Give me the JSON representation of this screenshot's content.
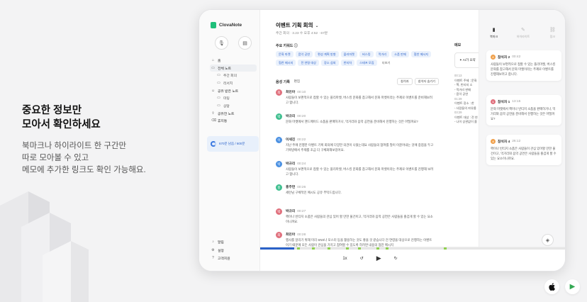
{
  "hero": {
    "headline_line1": "중요한 정보만",
    "headline_line2": "모아서 확인하세요",
    "body_line1": "북마크나 하이라이트 한 구간만",
    "body_line2": "따로 모아볼 수 있고",
    "body_line3": "메모에 추가한 링크도 확인 가능해요."
  },
  "app": {
    "logo_text": "ClovaNote",
    "sidebar": {
      "items": [
        {
          "label": "홈",
          "icon": "home-icon"
        },
        {
          "label": "전체 노트",
          "icon": "folder-icon"
        },
        {
          "label": "주간 회의",
          "icon": "folder-icon",
          "sub": true
        },
        {
          "label": "리서치",
          "icon": "folder-icon",
          "sub": true
        },
        {
          "label": "공유 받은 노트",
          "icon": "person-icon"
        },
        {
          "label": "미팅",
          "icon": "folder-icon",
          "sub": true
        },
        {
          "label": "상담",
          "icon": "folder-icon",
          "sub": true
        },
        {
          "label": "공유한 노트",
          "icon": "share-icon"
        },
        {
          "label": "휴지통",
          "icon": "trash-icon"
        }
      ],
      "storage": "670분 남음 / 600분",
      "bottom_items": [
        {
          "label": "알림",
          "icon": "bell-icon"
        },
        {
          "label": "설정",
          "icon": "gear-icon"
        },
        {
          "label": "고객지원",
          "icon": "help-icon"
        }
      ]
    },
    "note": {
      "title": "이벤트 기획 회의",
      "subtitle": "주간 회의 · 3.23 수 오후 4:52 · 67분",
      "keywords_label": "주요 키워드",
      "keywords": [
        "문화 마켓",
        "음악 공연",
        "편성 계획 방향",
        "플리마켓",
        "버스킹",
        "먹거리",
        "소품 판매",
        "협찬 메시지",
        "협찬 메시지",
        "전 연령 대상",
        "장소 섭외",
        "반지차",
        "스태프 모집"
      ],
      "keywords_more": "더보기",
      "record_label": "음성 기록",
      "record_edit": "편집",
      "btn_participants": "참석자",
      "btn_hide": "참석자 숨기기",
      "segments": [
        {
          "speaker": "최민아",
          "time": "00:10",
          "color": "#e0707d",
          "initial": "최",
          "text": "사람들이 보편적으로 접할 수 있는 플리마켓, 버스킹 문화를 참고해서 문화 마켓이라는 주제로 이벤트를 준비해보려고 합니다."
        },
        {
          "speaker": "박규리",
          "time": "00:20",
          "color": "#3fbf8f",
          "initial": "박",
          "text": "문화 마켓에서 핸드메이드 소품을 판매하거나, 먹거리와 음악 공연을 준비해서 진행하는 것은 어떨까요?"
        },
        {
          "speaker": "이세진",
          "time": "00:22",
          "color": "#4a90e2",
          "initial": "이",
          "text": "지난 주에 진행한 이벤트 기획 회의에 다양한 의견이 나왔는데요 사람들의 참여를 많이 이끌어내는 것에 중점을 두고 기획방에서 주제를 조금 더 구체화해보았어요."
        },
        {
          "speaker": "박규리",
          "time": "00:24",
          "color": "#4a90e2",
          "initial": "박",
          "text": "사람들이 보편적으로 접할 수 있는 플리마켓, 버스킹 문화를 참고해서 문화 마켓이라는 주제로 이벤트를 진행해 보려고 합니다."
        },
        {
          "speaker": "홍주연",
          "time": "00:26",
          "color": "#3fbf8f",
          "initial": "홍",
          "text": "세런님 구체적인 예시도 공유 부탁드립니다."
        },
        {
          "speaker": "박규리",
          "time": "00:27",
          "color": "#e0707d",
          "initial": "박",
          "text": "핵이나 빈티지 소품은 사람들의 관심 있어 할 만한 물건이고, 먹거리와 음악 공연은 사람들을 즐겁게 할 수 있는 요소이니까요."
        },
        {
          "speaker": "최민아",
          "time": "00:28",
          "color": "#e0707d",
          "initial": "최",
          "text": "행사를 알리기 위해 미리 SNS나 포스터 등을 활용하는 것도 좋을 것 같습니다 전 연령을 대상으로 진행하는 이벤트이기 때문에 모든 사람이 관심을 가지고 참여할 수 있도록 하려면 내용의 협찬 메시지"
        }
      ]
    },
    "player": {
      "speed": "1x",
      "progress": 0.11,
      "markers": [
        0.12,
        0.17,
        0.22,
        0.28,
        0.32,
        0.38,
        0.41,
        0.6
      ]
    },
    "memo": {
      "label": "메모",
      "ai_box": "AI가 요약",
      "lines": [
        {
          "ts": "00:13",
          "text": "이벤트 주제 : 문화"
        },
        {
          "ts": "",
          "text": "- 핵, 빈티지 소"
        },
        {
          "ts": "",
          "text": "- 먹거리 판매"
        },
        {
          "ts": "",
          "text": "- 음악 공연"
        },
        {
          "ts": "01:29",
          "text": "이벤트 장소 : 한"
        },
        {
          "ts": "",
          "text": "- 사람들의 자유롭"
        },
        {
          "ts": "03:29",
          "text": "이벤트 대상 : 전 연"
        },
        {
          "ts": "",
          "text": "- 나이 상관없이 즐"
        }
      ]
    },
    "panel": {
      "tabs": [
        {
          "label": "북마크",
          "icon": "bookmark-icon",
          "active": true
        },
        {
          "label": "하이라이트",
          "icon": "highlight-icon",
          "active": false
        },
        {
          "label": "링크",
          "icon": "link-icon",
          "active": false
        }
      ],
      "cards": [
        {
          "speaker": "참석자 2",
          "time": "00:42",
          "color": "#f0a04b",
          "initial": "2",
          "text": "사람들이 보편적으로 접할 수 있는 플리마켓, 버스킹 문화를 참고해서 문화 마켓이라는 주제로 이벤트를 진행해보려고 합니다."
        },
        {
          "speaker": "참석자 1",
          "time": "13:15",
          "color": "#e0707d",
          "initial": "1",
          "text": "문화 마켓에서 핵이나 빈티지 소품을 판매하거나, 먹거리와 음악 공연을 준비해서 진행하는 것은 어떨까요?"
        },
        {
          "speaker": "참석자 4",
          "time": "26:12",
          "color": "#f0a04b",
          "initial": "4",
          "text": "핵이나 빈티지 소품은 사람들이 관심 있어할 만한 물건이고, 먹거리와 음악 공연은 사람들을 즐겁게 할 수 있는 요소이니까요."
        }
      ]
    }
  }
}
